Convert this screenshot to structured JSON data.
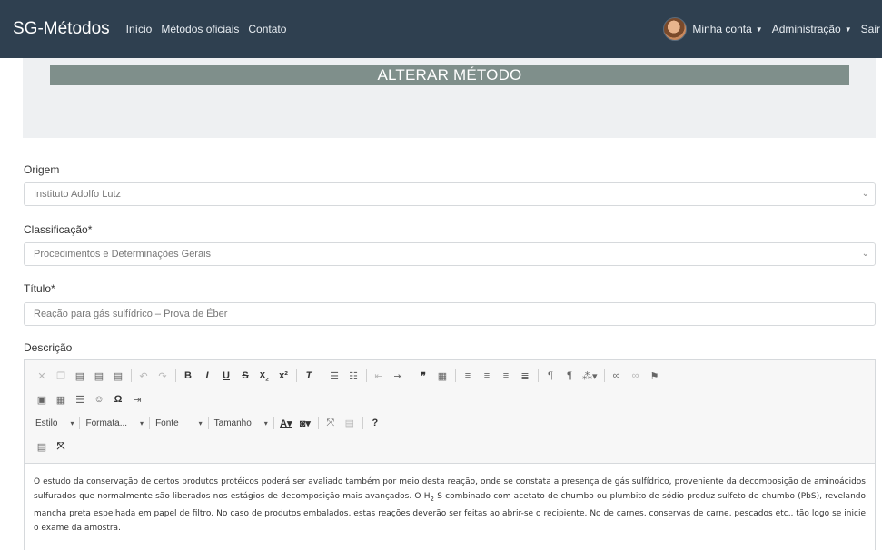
{
  "navbar": {
    "brand": "SG-Métodos",
    "links": [
      "Início",
      "Métodos oficiais",
      "Contato"
    ],
    "account": "Minha conta",
    "admin": "Administração",
    "logout": "Sair"
  },
  "header": {
    "title": "ALTERAR MÉTODO"
  },
  "form": {
    "origem_label": "Origem",
    "origem_value": "Instituto Adolfo Lutz",
    "classificacao_label": "Classificação*",
    "classificacao_value": "Procedimentos e Determinações Gerais",
    "titulo_label": "Título*",
    "titulo_value": "Reação para gás sulfídrico – Prova de Éber",
    "descricao_label": "Descrição"
  },
  "editor": {
    "combos": {
      "style": "Estilo",
      "format": "Formata...",
      "font": "Fonte",
      "size": "Tamanho"
    },
    "content_part1": "O estudo da conservação de certos produtos protéicos poderá ser avaliado também por meio desta reação, onde se constata a presença de gás sulfídrico, proveniente da decomposição de aminoácidos sulfurados que normalmente são liberados nos estágios de decomposição mais avançados. O H",
    "content_sub": "2",
    "content_part2": " S combinado com acetato de chumbo ou plumbito de sódio produz sulfeto de chumbo (PbS), revelando mancha preta espelhada em papel de filtro. No caso de produtos embalados, estas reações deverão ser feitas ao abrir-se o recipiente. No de carnes, conservas de carne, pescados etc., tão logo se inicie o exame da amostra."
  }
}
